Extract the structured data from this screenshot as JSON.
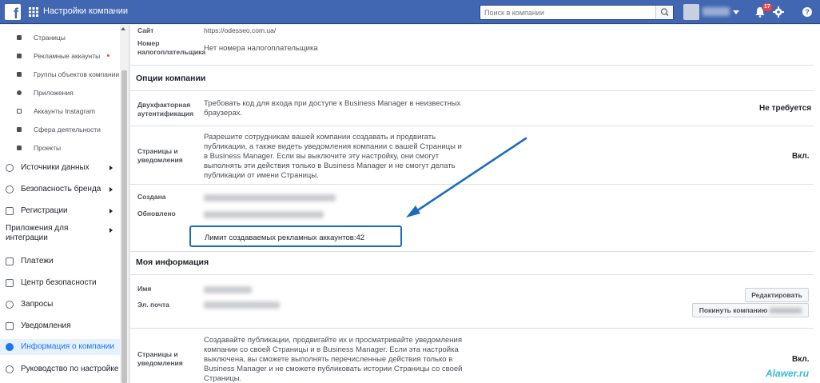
{
  "header": {
    "title": "Настройки компании",
    "search_placeholder": "Поиск в компании",
    "notifications_count": "17"
  },
  "sidebar": {
    "sub_items": [
      {
        "label": "Страницы"
      },
      {
        "label": "Рекламные аккаунты"
      },
      {
        "label": "Группы объектов компании"
      },
      {
        "label": "Приложения"
      },
      {
        "label": "Аккаунты Instagram"
      },
      {
        "label": "Сфера деятельности"
      },
      {
        "label": "Проекты"
      }
    ],
    "main_items": [
      {
        "label": "Источники данных"
      },
      {
        "label": "Безопасность бренда"
      },
      {
        "label": "Регистрации"
      },
      {
        "label": "Приложения для интеграции"
      },
      {
        "label": "Платежи"
      },
      {
        "label": "Центр безопасности"
      },
      {
        "label": "Запросы"
      },
      {
        "label": "Уведомления"
      },
      {
        "label": "Информация о компании"
      },
      {
        "label": "Руководство по настройке"
      }
    ]
  },
  "info": {
    "site_label": "Сайт",
    "site_value": "https://odesseo.com.ua/",
    "tax_label": "Номер налогоплательщика",
    "tax_value": "Нет номера налогоплательщика"
  },
  "company_options": {
    "title": "Опции компании",
    "twofa_label": "Двухфакторная аутентификация",
    "twofa_desc": "Требовать код для входа при доступе к Business Manager в неизвестных браузерах.",
    "twofa_value": "Не требуется",
    "pages_label": "Страницы и уведомления",
    "pages_desc": "Разрешите сотрудникам вашей компании создавать и продвигать публикации, а также видеть уведомления компании с вашей Страницы и в Business Manager. Если вы выключите эту настройку, они смогут выполнять эти действия только в Business Manager и не смогут делать публикации от имени Страницы.",
    "pages_value": "Вкл.",
    "created_label": "Создана",
    "updated_label": "Обновлено",
    "limit_text": "Лимит создаваемых рекламных аккаунтов:42"
  },
  "my_info": {
    "title": "Моя информация",
    "name_label": "Имя",
    "email_label": "Эл. почта",
    "edit_button": "Редактировать",
    "leave_button": "Покинуть компанию",
    "pages_label": "Страницы и уведомления",
    "pages_desc": "Создавайте публикации, продвигайте их и просматривайте уведомления компании со своей Страницы и в Business Manager. Если эта настройка выключена, вы сможете выполнять перечисленные действия только в Business Manager и не сможете публиковать истории Страницы со своей Страницы.",
    "pages_value": "Вкл."
  },
  "watermark": "Alawer.ru",
  "colors": {
    "header": "#4267b2",
    "arrow": "#1b6cbf",
    "highlight": "#1b6cbf"
  }
}
